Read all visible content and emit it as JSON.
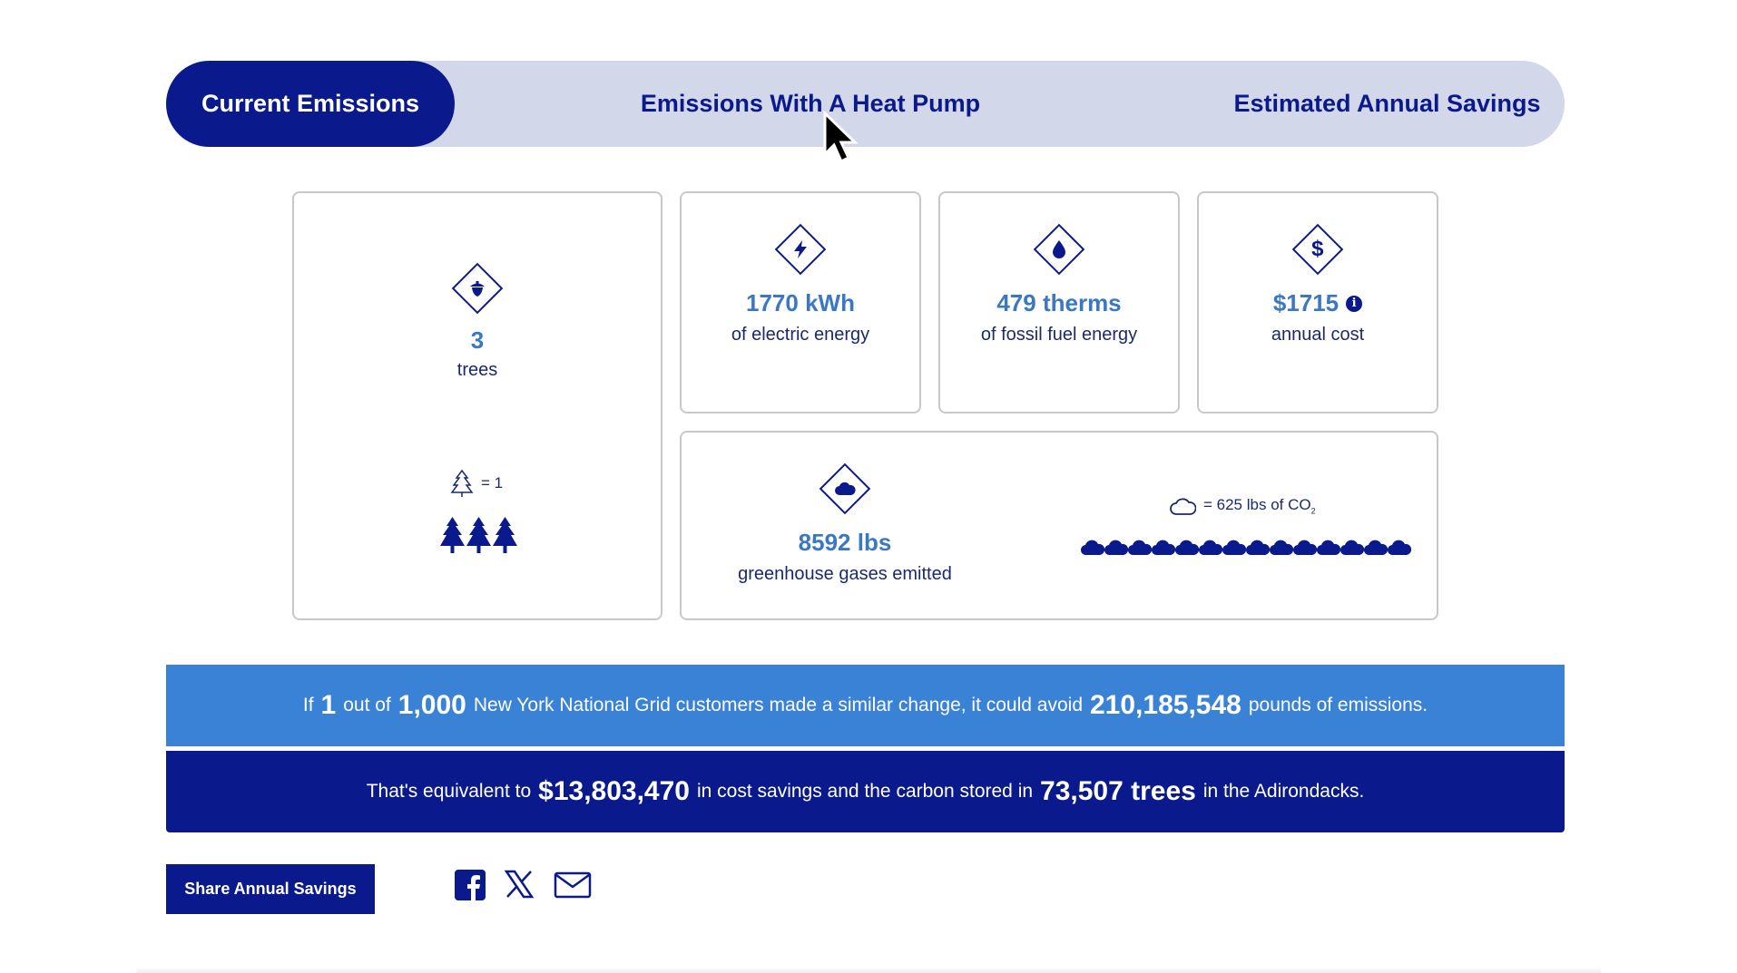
{
  "tabs": [
    {
      "label": "Current Emissions",
      "active": true
    },
    {
      "label": "Emissions With A Heat Pump",
      "active": false
    },
    {
      "label": "Estimated Annual Savings",
      "active": false
    }
  ],
  "cards": {
    "trees": {
      "icon": "acorn-icon",
      "value": "3",
      "label": "trees",
      "legend": "= 1",
      "tree_count": 3
    },
    "electric": {
      "icon": "lightning-icon",
      "value": "1770 kWh",
      "label": "of electric energy"
    },
    "fossil": {
      "icon": "flame-drop-icon",
      "value": "479 therms",
      "label": "of fossil fuel energy"
    },
    "cost": {
      "icon": "dollar-icon",
      "value": "$1715",
      "label": "annual cost"
    },
    "ghg": {
      "icon": "cloud-icon",
      "value": "8592 lbs",
      "label": "greenhouse gases emitted",
      "legend_prefix": "= 625 lbs of CO",
      "legend_sub": "2",
      "cloud_count": 14
    }
  },
  "banner1": {
    "t1": "If",
    "n1": "1",
    "t2": "out of",
    "n2": "1,000",
    "t3": "New York National Grid customers made a similar change, it could avoid",
    "n3": "210,185,548",
    "t4": "pounds of emissions."
  },
  "banner2": {
    "t1": "That's equivalent to",
    "n1": "$13,803,470",
    "t2": "in cost savings and the carbon stored in",
    "n2": "73,507 trees",
    "t3": "in the Adirondacks."
  },
  "share": {
    "label": "Share Annual Savings"
  },
  "colors": {
    "navy": "#0a1a8c",
    "blue": "#3a82d6",
    "value_blue": "#3a78c5",
    "tab_bg": "#d3d7ea"
  }
}
